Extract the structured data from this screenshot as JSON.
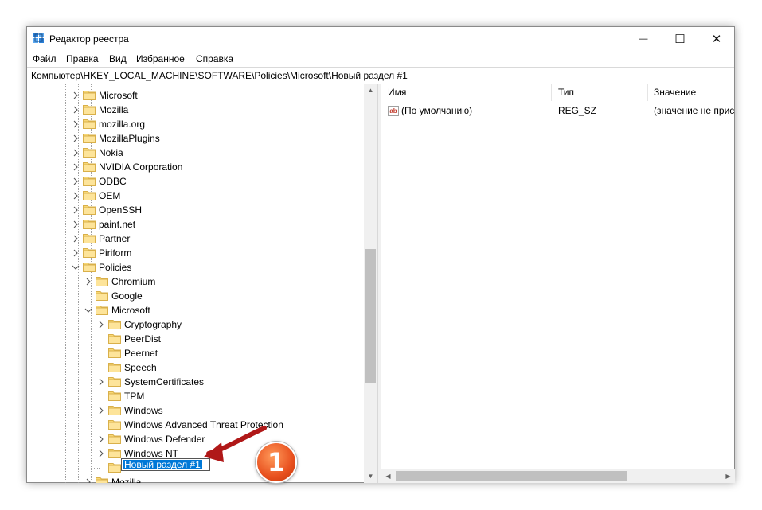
{
  "window": {
    "title": "Редактор реестра",
    "minimize_glyph": "—",
    "maximize_glyph": "☐",
    "close_glyph": "✕"
  },
  "menu": {
    "items": [
      "Файл",
      "Правка",
      "Вид",
      "Избранное",
      "Справка"
    ]
  },
  "address": {
    "path": "Компьютер\\HKEY_LOCAL_MACHINE\\SOFTWARE\\Policies\\Microsoft\\Новый раздел #1"
  },
  "tree": {
    "items": [
      {
        "label": "Microsoft",
        "level": 0,
        "expander": "collapsed"
      },
      {
        "label": "Mozilla",
        "level": 0,
        "expander": "collapsed"
      },
      {
        "label": "mozilla.org",
        "level": 0,
        "expander": "collapsed"
      },
      {
        "label": "MozillaPlugins",
        "level": 0,
        "expander": "collapsed"
      },
      {
        "label": "Nokia",
        "level": 0,
        "expander": "collapsed"
      },
      {
        "label": "NVIDIA Corporation",
        "level": 0,
        "expander": "collapsed"
      },
      {
        "label": "ODBC",
        "level": 0,
        "expander": "collapsed"
      },
      {
        "label": "OEM",
        "level": 0,
        "expander": "collapsed"
      },
      {
        "label": "OpenSSH",
        "level": 0,
        "expander": "collapsed"
      },
      {
        "label": "paint.net",
        "level": 0,
        "expander": "collapsed"
      },
      {
        "label": "Partner",
        "level": 0,
        "expander": "collapsed"
      },
      {
        "label": "Piriform",
        "level": 0,
        "expander": "collapsed"
      },
      {
        "label": "Policies",
        "level": 0,
        "expander": "expanded"
      },
      {
        "label": "Chromium",
        "level": 1,
        "expander": "collapsed"
      },
      {
        "label": "Google",
        "level": 1,
        "expander": "none"
      },
      {
        "label": "Microsoft",
        "level": 1,
        "expander": "expanded"
      },
      {
        "label": "Cryptography",
        "level": 2,
        "expander": "collapsed"
      },
      {
        "label": "PeerDist",
        "level": 2,
        "expander": "none"
      },
      {
        "label": "Peernet",
        "level": 2,
        "expander": "none"
      },
      {
        "label": "Speech",
        "level": 2,
        "expander": "none"
      },
      {
        "label": "SystemCertificates",
        "level": 2,
        "expander": "collapsed"
      },
      {
        "label": "TPM",
        "level": 2,
        "expander": "none"
      },
      {
        "label": "Windows",
        "level": 2,
        "expander": "collapsed"
      },
      {
        "label": "Windows Advanced Threat Protection",
        "level": 2,
        "expander": "none"
      },
      {
        "label": "Windows Defender",
        "level": 2,
        "expander": "collapsed"
      },
      {
        "label": "Windows NT",
        "level": 2,
        "expander": "collapsed"
      },
      {
        "label": "Новый раздел #1",
        "level": 2,
        "expander": "none",
        "editing": true
      },
      {
        "label": "Mozilla",
        "level": 1,
        "expander": "collapsed"
      }
    ]
  },
  "values": {
    "columns": [
      "Имя",
      "Тип",
      "Значение"
    ],
    "rows": [
      {
        "name": "(По умолчанию)",
        "type": "REG_SZ",
        "data": "(значение не прис",
        "icon": "string-value-icon",
        "icon_text": "ab"
      }
    ]
  },
  "callout": {
    "number": "1",
    "color": "#e8501e"
  }
}
